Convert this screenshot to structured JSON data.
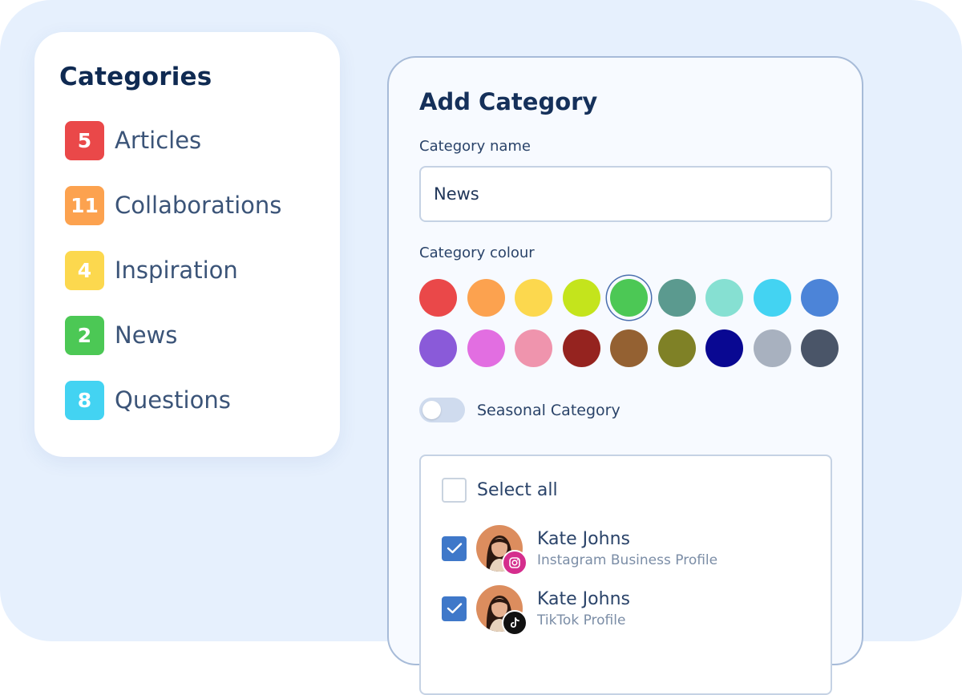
{
  "categories": {
    "title": "Categories",
    "items": [
      {
        "count": "5",
        "label": "Articles",
        "color": "#ea4849"
      },
      {
        "count": "11",
        "label": "Collaborations",
        "color": "#fca24f"
      },
      {
        "count": "4",
        "label": "Inspiration",
        "color": "#fcd84e"
      },
      {
        "count": "2",
        "label": "News",
        "color": "#4cc855"
      },
      {
        "count": "8",
        "label": "Questions",
        "color": "#43d3f2"
      }
    ]
  },
  "add_category": {
    "title": "Add Category",
    "name_label": "Category name",
    "name_value": "News",
    "colour_label": "Category colour",
    "selected_colour": "#4cc855",
    "colours_row1": [
      "#ea4849",
      "#fca24f",
      "#fcd84e",
      "#c4e41c",
      "#4cc855",
      "#5b9a8f",
      "#86e0d2",
      "#43d3f2",
      "#4c84d8"
    ],
    "colours_row2": [
      "#8a5ad9",
      "#e26ee1",
      "#ef94ad",
      "#95231f",
      "#946132",
      "#7f8126",
      "#090892",
      "#a8b1bf",
      "#4a5568"
    ],
    "seasonal_label": "Seasonal Category",
    "seasonal_enabled": false,
    "select_all_label": "Select all",
    "profiles": [
      {
        "name": "Kate Johns",
        "type": "Instagram Business Profile",
        "checked": true,
        "network_icon": "instagram-icon",
        "badge_color": "#d52e8d"
      },
      {
        "name": "Kate Johns",
        "type": "TikTok Profile",
        "checked": true,
        "network_icon": "tiktok-icon",
        "badge_color": "#111111"
      }
    ]
  }
}
